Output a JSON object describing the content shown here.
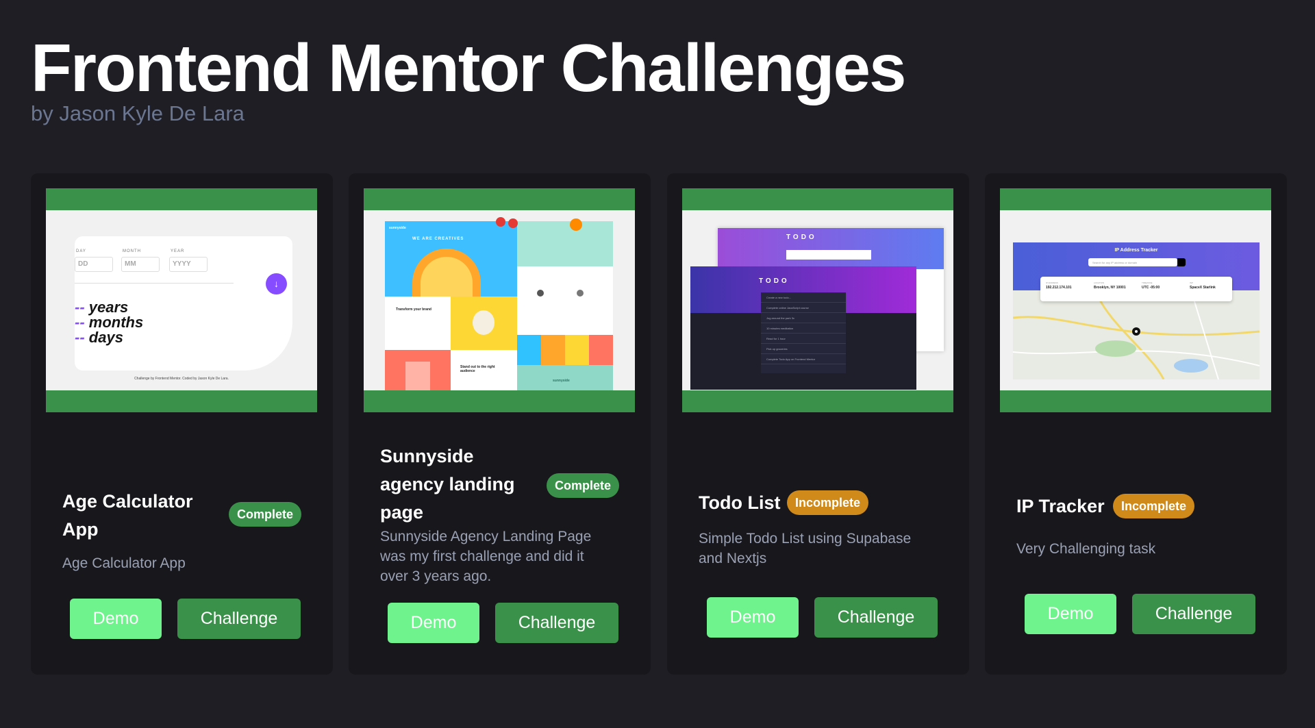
{
  "header": {
    "title": "Frontend Mentor Challenges",
    "subtitle": "by Jason Kyle De Lara"
  },
  "cards": [
    {
      "title_lines": [
        "Age Calculator",
        "App"
      ],
      "status": "Complete",
      "description_lines": [
        "Age Calculator App"
      ],
      "demo_label": "Demo",
      "challenge_label": "Challenge",
      "preview": {
        "labels": [
          "DAY",
          "MONTH",
          "YEAR"
        ],
        "placeholders": [
          "DD",
          "MM",
          "YYYY"
        ],
        "rows": [
          {
            "dash": "--",
            "word": "years"
          },
          {
            "dash": "--",
            "word": "months"
          },
          {
            "dash": "--",
            "word": "days"
          }
        ],
        "footer": "Challenge by Frontend Mentor. Coded by Jason Kyle De Lara."
      }
    },
    {
      "title_lines": [
        "Sunnyside",
        "agency landing",
        "page"
      ],
      "status": "Complete",
      "description_lines": [
        "Sunnyside Agency Landing Page",
        "was my first challenge and did it",
        "over 3 years ago."
      ],
      "demo_label": "Demo",
      "challenge_label": "Challenge",
      "preview": {
        "logo": "sunnyside",
        "hero": "WE ARE CREATIVES",
        "block1": "Transform your brand",
        "block2": "Stand out to the right audience",
        "footer_logo": "sunnyside"
      }
    },
    {
      "title_lines": [
        "Todo List"
      ],
      "status": "Incomplete",
      "description_lines": [
        "Simple Todo List using Supabase",
        "and Nextjs"
      ],
      "demo_label": "Demo",
      "challenge_label": "Challenge",
      "preview": {
        "heading": "TODO",
        "items": [
          "Create a new todo...",
          "Complete online JavaScript course",
          "Jog around the park 3x",
          "10 minutes meditation",
          "Read for 1 hour",
          "Pick up groceries",
          "Complete Todo App on Frontend Mentor"
        ]
      }
    },
    {
      "title_lines": [
        "IP Tracker"
      ],
      "status": "Incomplete",
      "description_lines": [
        "Very Challenging task"
      ],
      "demo_label": "Demo",
      "challenge_label": "Challenge",
      "preview": {
        "heading": "IP Address Tracker",
        "search_placeholder": "Search for any IP address or domain",
        "fields": [
          {
            "label": "IP ADDRESS",
            "value": "192.212.174.101"
          },
          {
            "label": "LOCATION",
            "value": "Brooklyn, NY 10001"
          },
          {
            "label": "TIMEZONE",
            "value": "UTC -05:00"
          },
          {
            "label": "ISP",
            "value": "SpaceX Starlink"
          }
        ]
      }
    }
  ],
  "colors": {
    "background": "#1e1e24",
    "card": "#18181c",
    "complete": "#3a9149",
    "incomplete": "#d08a1a",
    "demo": "#6ff38d",
    "challenge": "#3a9149"
  }
}
